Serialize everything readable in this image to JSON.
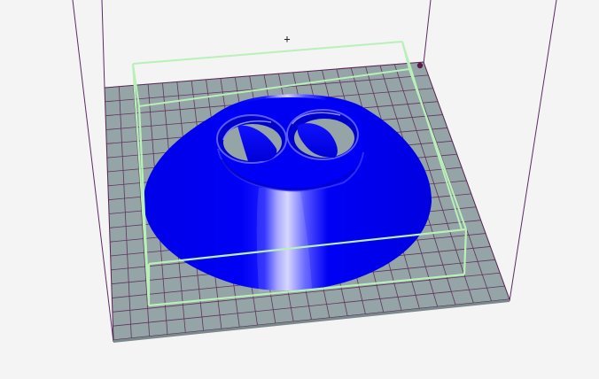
{
  "viewer": {
    "crosshair": "+",
    "icons": {
      "crosshair": "crosshair-icon",
      "origin_marker": "origin-dot-icon"
    },
    "colors": {
      "background": "#f4f4f4",
      "bed_plate": "#95a4a6",
      "grid_lines": "#5a2a55",
      "build_volume_edges": "#5c2a66",
      "bounding_box": "#b8f0b8",
      "model": "#0000f5",
      "model_highlight": "#c8c8ff",
      "origin_marker": "#5a1a4a"
    }
  }
}
